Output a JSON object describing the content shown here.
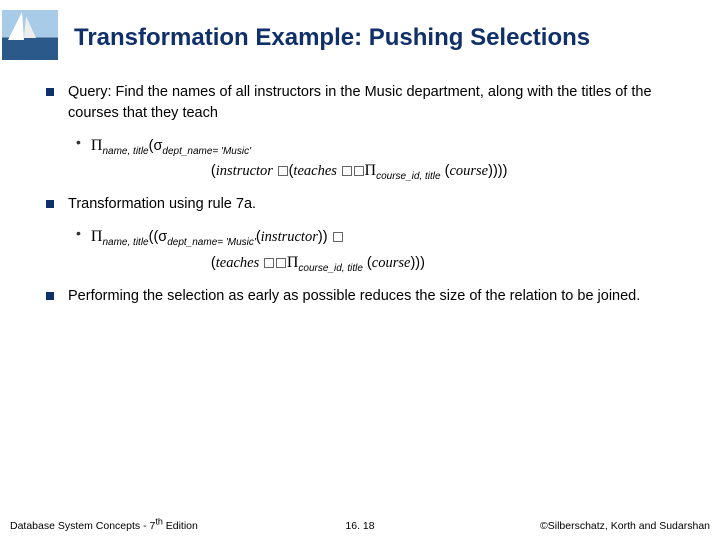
{
  "title": "Transformation Example: Pushing Selections",
  "bullets": {
    "b1": "Query:  Find the names of all instructors in the Music department, along with the titles of the courses that they teach",
    "b1_sub_line1_pre": "Π",
    "b1_sub_line1_sub1": "name, title",
    "b1_sub_line1_mid1": "(σ",
    "b1_sub_line1_sub2": "dept_name= 'Music'",
    "b1_sub_line2_a": "(",
    "b1_sub_line2_instr": "instructor ",
    "b1_sub_line2_b": "(",
    "b1_sub_line2_teach": "teaches ",
    "b1_sub_line2_pi": "Π",
    "b1_sub_line2_sub": "course_id, title",
    "b1_sub_line2_c": " (",
    "b1_sub_line2_course": "course",
    "b1_sub_line2_d": "))))",
    "b2": "Transformation using rule 7a.",
    "b2_sub_line1_pre": "Π",
    "b2_sub_line1_sub1": "name, title",
    "b2_sub_line1_mid1": "((σ",
    "b2_sub_line1_sub2": "dept_name= 'Music'",
    "b2_sub_line1_mid2": "(",
    "b2_sub_line1_instr": "instructor",
    "b2_sub_line1_mid3": ")) ",
    "b2_sub_line2_a": "(",
    "b2_sub_line2_teach": "teaches ",
    "b2_sub_line2_pi": "Π",
    "b2_sub_line2_sub": "course_id, title",
    "b2_sub_line2_b": " (",
    "b2_sub_line2_course": "course",
    "b2_sub_line2_c": ")))",
    "b3": "Performing the selection as early as possible reduces the size of the relation to be joined."
  },
  "footer": {
    "left_a": "Database System Concepts - 7",
    "left_b": " Edition",
    "left_sup": "th",
    "center": "16. 18",
    "right": "©Silberschatz, Korth and Sudarshan"
  }
}
